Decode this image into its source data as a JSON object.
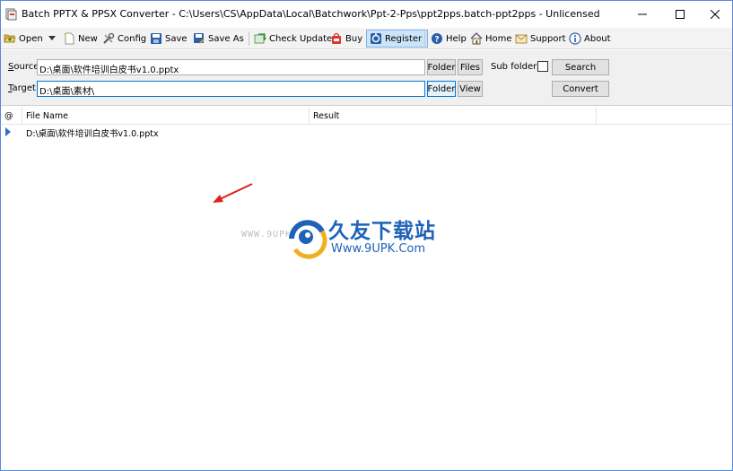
{
  "window": {
    "title": "Batch PPTX & PPSX Converter - C:\\Users\\CS\\AppData\\Local\\Batchwork\\Ppt-2-Pps\\ppt2pps.batch-ppt2pps - Unlicensed"
  },
  "toolbar": {
    "open": "Open",
    "new": "New",
    "config": "Config",
    "save": "Save",
    "save_as": "Save As",
    "check_update": "Check Update",
    "buy": "Buy",
    "register": "Register",
    "help": "Help",
    "home": "Home",
    "support": "Support",
    "about": "About"
  },
  "paths": {
    "source_label_key": "S",
    "source_label_rest": "ource",
    "source_value": "D:\\桌面\\软件培训白皮书v1.0.pptx",
    "target_label_key": "T",
    "target_label_rest": "arget",
    "target_value": "D:\\桌面\\素材\\",
    "folder_button": "Folder",
    "files_button": "Files",
    "view_button": "View",
    "subfolders_label": "Sub folders",
    "search_button": "Search",
    "convert_button": "Convert"
  },
  "grid": {
    "columns": [
      "@",
      "File Name",
      "Result"
    ],
    "rows": [
      {
        "file_name": "D:\\桌面\\软件培训白皮书v1.0.pptx",
        "result": ""
      }
    ]
  },
  "watermark": {
    "url_left": "WWW.9UPK.COM",
    "title": "久友下载站",
    "subtitle": "Www.9UPK.Com"
  },
  "colors": {
    "accent": "#0078d7",
    "watermark_blue": "#1f62b8",
    "arrow_red": "#e02020"
  }
}
